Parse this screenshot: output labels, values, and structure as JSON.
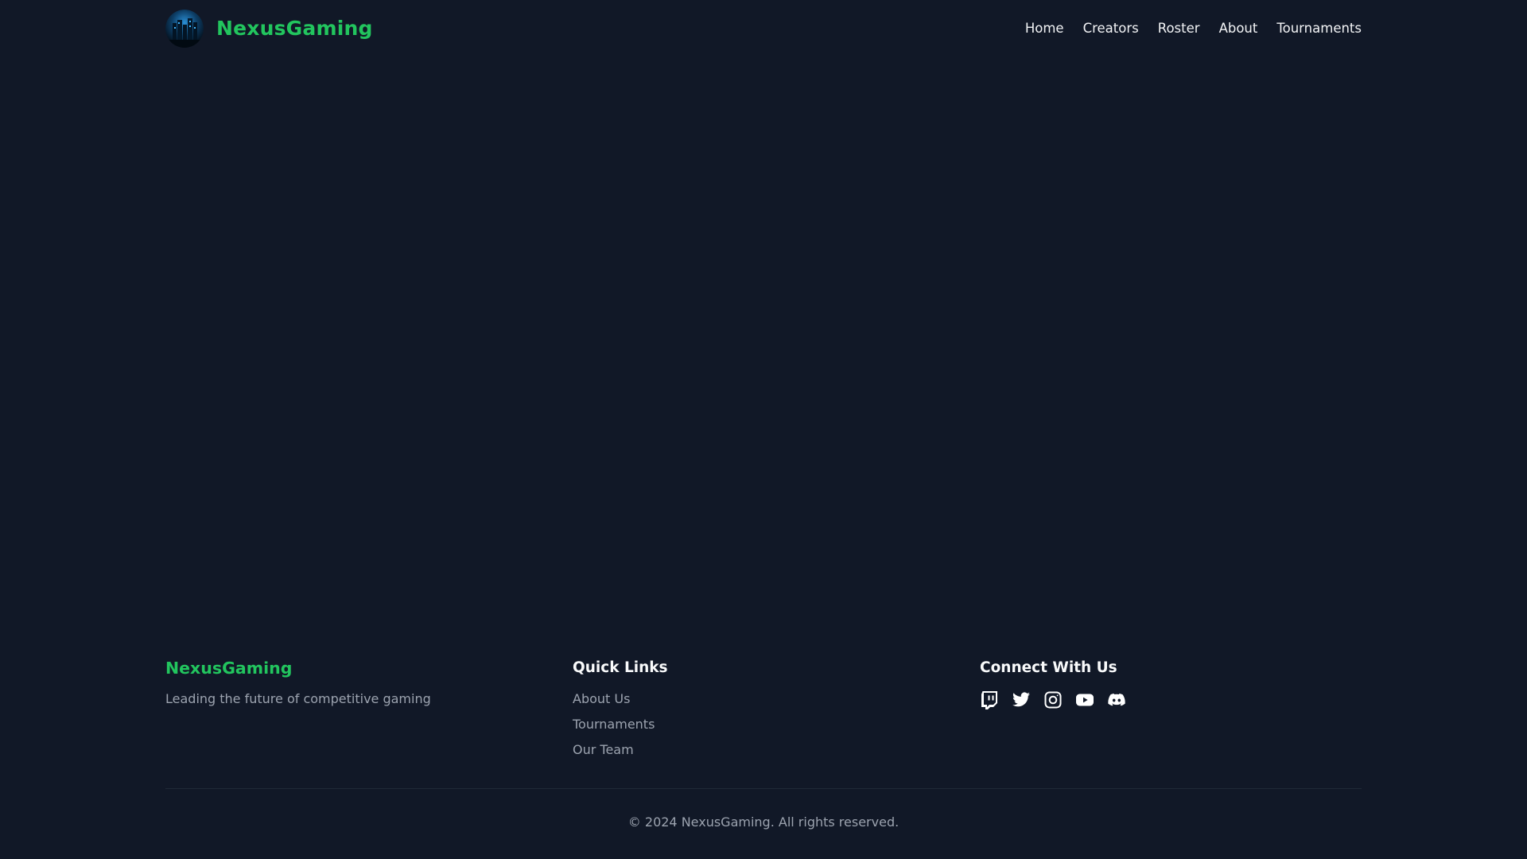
{
  "header": {
    "brand": "NexusGaming",
    "logo_icon": "nexus-logo-icon",
    "nav": [
      {
        "label": "Home"
      },
      {
        "label": "Creators"
      },
      {
        "label": "Roster"
      },
      {
        "label": "About"
      },
      {
        "label": "Tournaments"
      }
    ]
  },
  "footer": {
    "brand": "NexusGaming",
    "tagline": "Leading the future of competitive gaming",
    "quick_links": {
      "heading": "Quick Links",
      "items": [
        {
          "label": "About Us"
        },
        {
          "label": "Tournaments"
        },
        {
          "label": "Our Team"
        }
      ]
    },
    "connect": {
      "heading": "Connect With Us",
      "icons": [
        "twitch-icon",
        "twitter-icon",
        "instagram-icon",
        "youtube-icon",
        "discord-icon"
      ]
    },
    "copyright": "© 2024 NexusGaming. All rights reserved."
  },
  "colors": {
    "background": "#111827",
    "accent": "#22c55e",
    "text": "#f3f4f6",
    "muted": "#9ca3af",
    "divider": "#1f2937"
  }
}
